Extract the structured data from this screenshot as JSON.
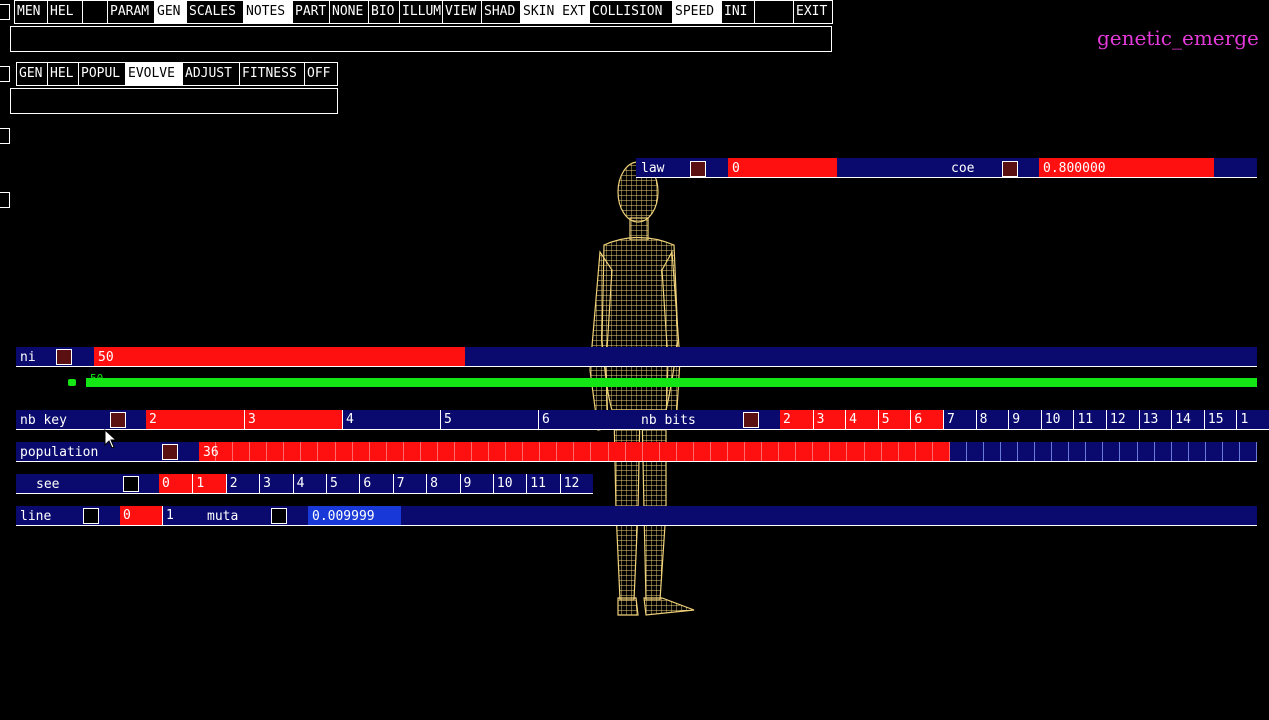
{
  "app_title": "genetic_emerge",
  "menu_bar": [
    {
      "label": "MEN",
      "active": false
    },
    {
      "label": "HEL",
      "active": false
    },
    {
      "label": "",
      "active": false
    },
    {
      "label": "PARAM",
      "active": false
    },
    {
      "label": "GEN",
      "active": true
    },
    {
      "label": "SCALES",
      "active": false
    },
    {
      "label": "NOTES",
      "active": true
    },
    {
      "label": "PART",
      "active": false
    },
    {
      "label": "NONE",
      "active": false
    },
    {
      "label": "BIO",
      "active": false
    },
    {
      "label": "ILLUM",
      "active": false
    },
    {
      "label": "VIEW",
      "active": false
    },
    {
      "label": "SHAD",
      "active": false
    },
    {
      "label": "SKIN EXT",
      "active": true
    },
    {
      "label": "COLLISION",
      "active": false
    },
    {
      "label": "SPEED",
      "active": true
    },
    {
      "label": "INI",
      "active": false
    },
    {
      "label": "",
      "active": false
    },
    {
      "label": "EXIT",
      "active": false
    }
  ],
  "sub_menu": [
    {
      "label": "GEN",
      "active": false
    },
    {
      "label": "HEL",
      "active": false
    },
    {
      "label": "POPUL",
      "active": false
    },
    {
      "label": "EVOLVE",
      "active": true
    },
    {
      "label": "ADJUST",
      "active": false
    },
    {
      "label": "FITNESS",
      "active": false
    },
    {
      "label": "OFF",
      "active": false
    }
  ],
  "law_slider": {
    "label": "law",
    "value": "0"
  },
  "coe_slider": {
    "label": "coe",
    "value": "0.800000"
  },
  "ni_slider": {
    "label": "ni",
    "value": "50",
    "fill_fraction": 0.31
  },
  "green_slider": {
    "value": "50",
    "fill_fraction": 1.0
  },
  "nb_key": {
    "label": "nb key",
    "ticks": [
      "2",
      "3",
      "4",
      "5",
      "6"
    ],
    "selected_count": 2
  },
  "nb_bits": {
    "label": "nb bits",
    "ticks": [
      "2",
      "3",
      "4",
      "5",
      "6",
      "7",
      "8",
      "9",
      "10",
      "11",
      "12",
      "13",
      "14",
      "15",
      "1"
    ],
    "selected_count": 5
  },
  "population": {
    "label": "population",
    "value": "36",
    "fill_fraction": 0.71
  },
  "see": {
    "label": "see",
    "ticks": [
      "0",
      "1",
      "2",
      "3",
      "4",
      "5",
      "6",
      "7",
      "8",
      "9",
      "10",
      "11",
      "12"
    ],
    "selected_count": 2
  },
  "line": {
    "label": "line",
    "ticks": [
      "0",
      "1"
    ],
    "selected_count": 1
  },
  "muta": {
    "label": "muta",
    "value": "0.009999"
  },
  "colors": {
    "accent_red": "#ff1010",
    "slider_blue": "#0a0a6e",
    "green": "#14e514",
    "title_magenta": "#e33ad9",
    "figure_wire": "#f0d27a"
  }
}
